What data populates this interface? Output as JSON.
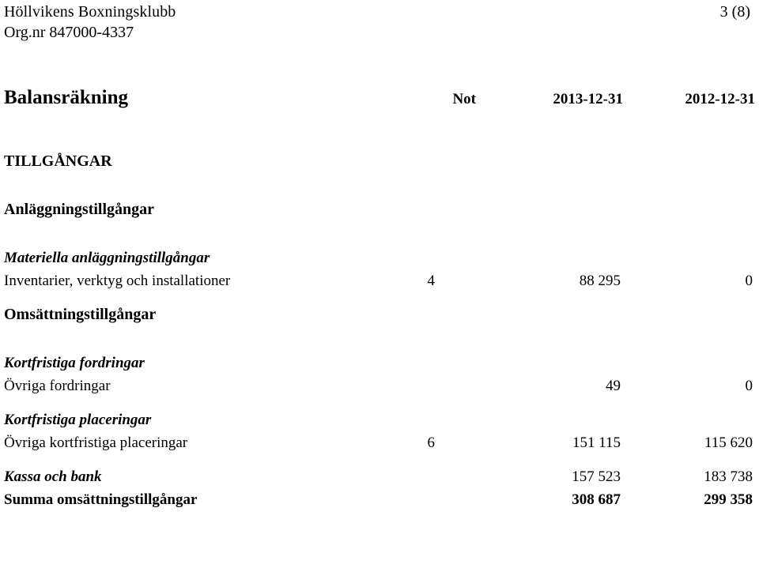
{
  "header": {
    "organisation": "Höllvikens Boxningsklubb",
    "org_number": "Org.nr 847000-4337",
    "page_indicator": "3 (8)"
  },
  "statement": {
    "title": "Balansräkning",
    "columns": {
      "note": "Not",
      "year_current": "2013-12-31",
      "year_previous": "2012-12-31"
    }
  },
  "sections": {
    "assets_heading": "TILLGÅNGAR",
    "fixed_assets_heading": "Anläggningstillgångar",
    "tangible_group": "Materiella anläggningstillgångar",
    "current_assets_heading": "Omsättningstillgångar",
    "receivables_group": "Kortfristiga fordringar",
    "investments_group": "Kortfristiga placeringar"
  },
  "rows": [
    {
      "label": "Inventarier, verktyg och installationer",
      "note": "4",
      "year_current": "88 295",
      "year_previous": "0"
    },
    {
      "label": "Övriga fordringar",
      "note": "",
      "year_current": "49",
      "year_previous": "0"
    },
    {
      "label": "Övriga kortfristiga placeringar",
      "note": "6",
      "year_current": "151 115",
      "year_previous": "115 620"
    },
    {
      "label": "Kassa och bank",
      "note": "",
      "year_current": "157 523",
      "year_previous": "183 738"
    },
    {
      "label": "Summa omsättningstillgångar",
      "note": "",
      "year_current": "308 687",
      "year_previous": "299 358"
    }
  ]
}
